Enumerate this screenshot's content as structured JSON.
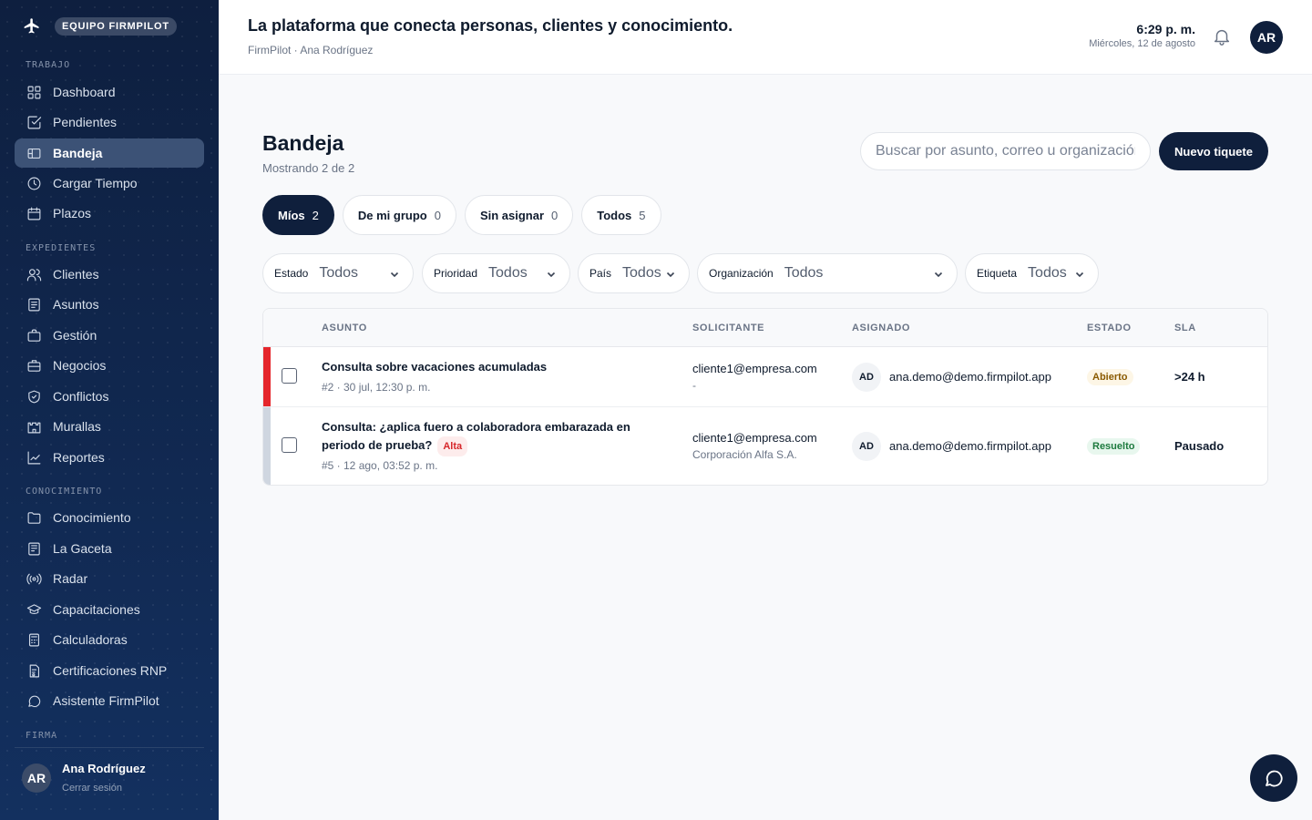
{
  "sidebar": {
    "brand_label": "EQUIPO FIRMPILOT",
    "sections": {
      "trabajo": "TRABAJO",
      "expedientes": "EXPEDIENTES",
      "conocimiento": "CONOCIMIENTO",
      "firma": "FIRMA"
    },
    "items": [
      {
        "label": "Dashboard",
        "icon": "grid-icon"
      },
      {
        "label": "Pendientes",
        "icon": "check-square-icon"
      },
      {
        "label": "Bandeja",
        "icon": "ticket-icon",
        "active": true
      },
      {
        "label": "Cargar Tiempo",
        "icon": "clock-icon"
      },
      {
        "label": "Plazos",
        "icon": "calendar-icon"
      },
      {
        "label": "Clientes",
        "icon": "users-icon"
      },
      {
        "label": "Asuntos",
        "icon": "file-text-icon"
      },
      {
        "label": "Gestión",
        "icon": "briefcase-icon"
      },
      {
        "label": "Negocios",
        "icon": "briefcase-stack-icon"
      },
      {
        "label": "Conflictos",
        "icon": "shield-icon"
      },
      {
        "label": "Murallas",
        "icon": "castle-icon"
      },
      {
        "label": "Reportes",
        "icon": "line-chart-icon"
      },
      {
        "label": "Conocimiento",
        "icon": "folder-icon"
      },
      {
        "label": "La Gaceta",
        "icon": "newspaper-icon"
      },
      {
        "label": "Radar",
        "icon": "radar-icon"
      },
      {
        "label": "Capacitaciones",
        "icon": "graduation-cap-icon"
      },
      {
        "label": "Calculadoras",
        "icon": "calculator-icon"
      },
      {
        "label": "Certificaciones RNP",
        "icon": "certificate-icon"
      },
      {
        "label": "Asistente FirmPilot",
        "icon": "chat-bubble-icon"
      }
    ],
    "user": {
      "initials": "AR",
      "name": "Ana Rodríguez",
      "logout": "Cerrar sesión"
    }
  },
  "header": {
    "title": "La plataforma que conecta personas, clientes y conocimiento.",
    "subtitle": "FirmPilot · Ana Rodríguez",
    "time": "6:29 p. m.",
    "date": "Miércoles, 12 de agosto",
    "avatar": "AR"
  },
  "main": {
    "title": "Bandeja",
    "count": "Mostrando 2 de 2",
    "search_placeholder": "Buscar por asunto, correo u organización",
    "new_button": "Nuevo tiquete",
    "tabs": [
      {
        "label": "Míos",
        "count": "2",
        "active": true
      },
      {
        "label": "De mi grupo",
        "count": "0"
      },
      {
        "label": "Sin asignar",
        "count": "0"
      },
      {
        "label": "Todos",
        "count": "5"
      }
    ],
    "filters": [
      {
        "label": "Estado",
        "value": "Todos"
      },
      {
        "label": "Prioridad",
        "value": "Todos"
      },
      {
        "label": "País",
        "value": "Todos"
      },
      {
        "label": "Organización",
        "value": "Todos"
      },
      {
        "label": "Etiqueta",
        "value": "Todos"
      }
    ],
    "columns": [
      "ASUNTO",
      "SOLICITANTE",
      "ASIGNADO",
      "ESTADO",
      "SLA"
    ],
    "rows": [
      {
        "subject": "Consulta sobre vacaciones acumuladas",
        "meta": "#2 · 30 jul, 12:30 p. m.",
        "requester": "cliente1@empresa.com",
        "org": "-",
        "assignee_initials": "AD",
        "assignee": "ana.demo@demo.firmpilot.app",
        "status": "Abierto",
        "sla": ">24 h",
        "bar_color": "#e5262c"
      },
      {
        "subject_line1": "Consulta: ¿aplica fuero a colaboradora embarazada en",
        "subject_line2": "periodo de prueba?",
        "priority": "Alta",
        "meta": "#5 · 12 ago, 03:52 p. m.",
        "requester": "cliente1@empresa.com",
        "org": "Corporación Alfa S.A.",
        "assignee_initials": "AD",
        "assignee": "ana.demo@demo.firmpilot.app",
        "status": "Resuelto",
        "sla": "Pausado",
        "bar_color": "#cfd6e0"
      }
    ]
  },
  "colors": {
    "navy": "#0f1f3c",
    "sidebar": "#0f2244",
    "alert": "#e5262c"
  }
}
